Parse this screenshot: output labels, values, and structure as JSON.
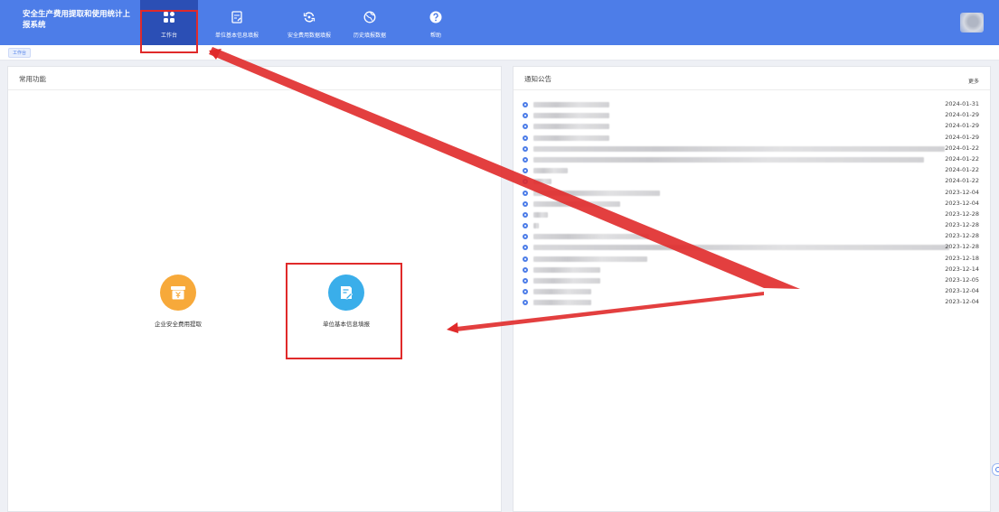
{
  "header": {
    "app_title": "安全生产费用提取和使用统计上报系统",
    "nav": [
      {
        "label": "工作台",
        "icon": "grid-icon",
        "active": true
      },
      {
        "label": "单位基本信息填报",
        "icon": "edit-form-icon",
        "active": false
      },
      {
        "label": "安全费用数据填报",
        "icon": "refresh-cycle-icon",
        "active": false
      },
      {
        "label": "历史填报数据",
        "icon": "globe-icon",
        "active": false
      },
      {
        "label": "帮助",
        "icon": "question-icon",
        "active": false
      }
    ]
  },
  "breadcrumb": {
    "current": "工作台"
  },
  "left_panel": {
    "title": "常用功能",
    "functions": [
      {
        "label": "企业安全费用提取",
        "icon": "yuan-box-icon",
        "color": "#f7a93a"
      },
      {
        "label": "单位基本信息填报",
        "icon": "edit-document-icon",
        "color": "#3aaeea"
      }
    ]
  },
  "right_panel": {
    "title": "通知公告",
    "more_label": "更多",
    "notices": [
      {
        "date": "2024-01-31"
      },
      {
        "date": "2024-01-29"
      },
      {
        "date": "2024-01-29"
      },
      {
        "date": "2024-01-29"
      },
      {
        "date": "2024-01-22"
      },
      {
        "date": "2024-01-22"
      },
      {
        "date": "2024-01-22"
      },
      {
        "date": "2024-01-22"
      },
      {
        "date": "2023-12-04"
      },
      {
        "date": "2023-12-04"
      },
      {
        "date": "2023-12-28"
      },
      {
        "date": "2023-12-28"
      },
      {
        "date": "2023-12-28"
      },
      {
        "date": "2023-12-28"
      },
      {
        "date": "2023-12-18"
      },
      {
        "date": "2023-12-14"
      },
      {
        "date": "2023-12-05"
      },
      {
        "date": "2023-12-04"
      },
      {
        "date": "2023-12-04"
      }
    ]
  },
  "colors": {
    "primary": "#4d7de8",
    "active_nav": "#2b4fb5",
    "annotation": "#e02a2a"
  }
}
